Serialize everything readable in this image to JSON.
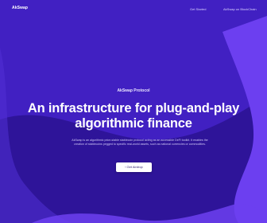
{
  "nav": {
    "logo_text": "AkSwap",
    "links": [
      {
        "label": "Get Started"
      },
      {
        "label": "AkSwap on BlockChain"
      }
    ]
  },
  "hero": {
    "eyebrow": "AkSwap Protocol",
    "headline_line1": "An infrastructure for plug-and-play",
    "headline_line2": "algorithmic finance",
    "description_line1": "AkSwap is an algorithmic price-stable stablecoin protocol acting as an accessible DeFi toolkit. It enables the",
    "description_line2": "creation of stablecoins pegged to specific real-world assets, such as national currencies or commodities.",
    "cta_label": "Get Airdrop",
    "cta_icon": "caret-left-icon"
  },
  "colors": {
    "background": "#4120c2",
    "wave_dark": "#2e1499",
    "wave_light": "#6c3ff0"
  }
}
